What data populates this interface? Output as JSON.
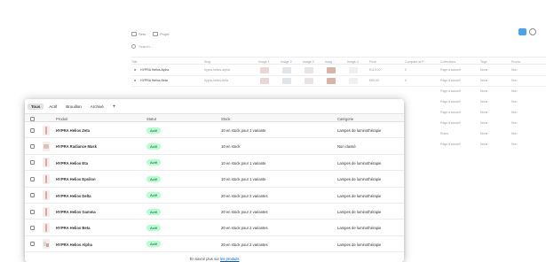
{
  "background_view": {
    "toolbar": [
      {
        "label": "Sets",
        "icon": "table-icon"
      },
      {
        "label": "Projet",
        "icon": "table-icon"
      }
    ],
    "search_placeholder": "Search...",
    "columns": [
      "Title",
      "Slug",
      "Image 1",
      "Image 2",
      "Image 3",
      "Imag...",
      "Image 4",
      "Price",
      "Compare at P...",
      "Collections",
      "Tags",
      "Promo"
    ],
    "rows": [
      {
        "title": "HYPRA Helios Alpha",
        "slug": "hypra-helios-alpha",
        "price": "€119,00",
        "compare": "0",
        "collection": "Page d'accueil",
        "tags": "None",
        "promo": "Non"
      },
      {
        "title": "HYPRA Helios Beta",
        "slug": "hypra-helios-beta",
        "price": "€59,00",
        "compare": "0",
        "collection": "Page d'accueil",
        "tags": "None",
        "promo": "Non"
      }
    ],
    "extra_rows": [
      {
        "collection": "Page d'accueil",
        "tags": "None",
        "promo": "Non"
      },
      {
        "collection": "Page d'accueil",
        "tags": "None",
        "promo": "Non"
      },
      {
        "collection": "Page d'accueil",
        "tags": "None",
        "promo": "Non"
      },
      {
        "collection": "Page d'accueil",
        "tags": "None",
        "promo": "Non"
      },
      {
        "collection": "Ruins",
        "tags": "None",
        "promo": "Non"
      },
      {
        "collection": "Page d'accueil",
        "tags": "None",
        "promo": "Non"
      }
    ],
    "colors": {
      "accent": "#4aa3f0"
    }
  },
  "panel": {
    "tabs": [
      "Tous",
      "Actif",
      "Brouillon",
      "Archivé",
      "+"
    ],
    "headers": {
      "product": "Produit",
      "status": "Statut",
      "stock": "Stock",
      "category": "Catégorie"
    },
    "products": [
      {
        "name": "HYPRA Helios Zeta",
        "status": "Actif",
        "stock": "10 en stock pour 1 variante",
        "category": "Lampes de luminothérapie",
        "thumb": "lamp"
      },
      {
        "name": "HYPRA Radiance Mask",
        "status": "Actif",
        "stock": "10 en stock",
        "category": "Non classé",
        "thumb": "mask"
      },
      {
        "name": "HYPRA Helios Eta",
        "status": "Actif",
        "stock": "10 en stock pour 1 variante",
        "category": "Lampes de luminothérapie",
        "thumb": "lamp"
      },
      {
        "name": "HYPRA Helios Epsilon",
        "status": "Actif",
        "stock": "10 en stock pour 1 variante",
        "category": "Lampes de luminothérapie",
        "thumb": "lamp"
      },
      {
        "name": "HYPRA Helios Delta",
        "status": "Actif",
        "stock": "20 en stock pour 2 variantes",
        "category": "Lampes de luminothérapie",
        "thumb": "lamp"
      },
      {
        "name": "HYPRA Helios Gamma",
        "status": "Actif",
        "stock": "20 en stock pour 2 variantes",
        "category": "Lampes de luminothérapie",
        "thumb": "lamp"
      },
      {
        "name": "HYPRA Helios Beta",
        "status": "Actif",
        "stock": "20 en stock pour 2 variantes",
        "category": "Lampes de luminothérapie",
        "thumb": "lamp"
      },
      {
        "name": "HYPRA Helios Alpha",
        "status": "Actif",
        "stock": "20 en stock pour 2 variantes",
        "category": "Lampes de luminothérapie",
        "thumb": "light"
      }
    ],
    "footer_text": "En savoir plus sur",
    "footer_link": "les produits",
    "colors": {
      "badge_bg": "#b4fed2",
      "badge_text": "#0c5132",
      "link": "#005bd3"
    }
  }
}
